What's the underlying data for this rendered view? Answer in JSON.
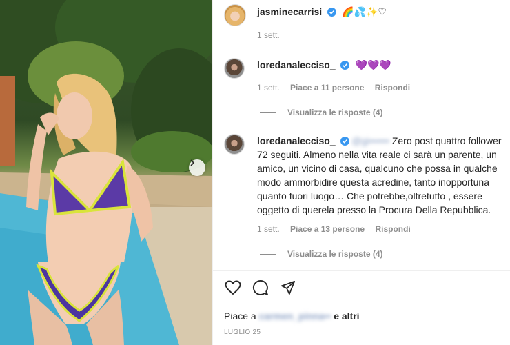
{
  "post": {
    "author": "jasminecarrisi",
    "caption_emojis": "🌈💦✨♡",
    "time": "1 sett."
  },
  "comments": [
    {
      "author": "loredanalecciso_",
      "text": "💜💜💜",
      "time": "1 sett.",
      "likes": "Piace a 11 persone",
      "reply": "Rispondi",
      "view_replies": "Visualizza le risposte (4)"
    },
    {
      "author": "loredanalecciso_",
      "mention": "@gi••••••",
      "text": "Zero post quattro follower 72 seguiti. Almeno nella vita reale ci sarà un parente, un amico, un vicino di casa, qualcuno che possa in qualche modo ammorbidire questa acredine, tanto inopportuna quanto fuori luogo… Che potrebbe,oltretutto , essere oggetto di querela presso la Procura Della Repubblica.",
      "time": "1 sett.",
      "likes": "Piace a 13 persone",
      "reply": "Rispondi",
      "view_replies": "Visualizza le risposte (4)"
    }
  ],
  "footer": {
    "likes_prefix": "Piace a",
    "likes_user": "carmen_pinna••",
    "likes_suffix": "e altri",
    "date": "LUGLIO 25"
  },
  "icons": {
    "like": "heart-icon",
    "comment": "comment-icon",
    "share": "send-icon",
    "verified": "verified-badge-icon",
    "next": "chevron-right-icon"
  },
  "colors": {
    "verified": "#3897f0",
    "muted": "#8e8e8e",
    "text": "#262626"
  }
}
